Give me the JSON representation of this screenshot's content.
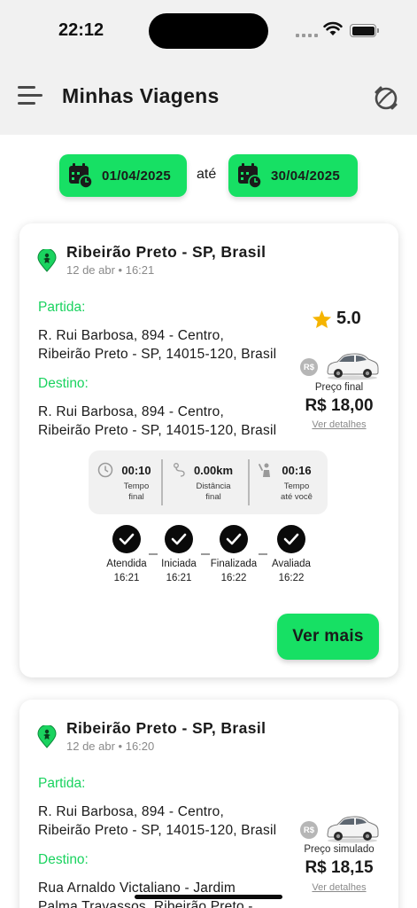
{
  "status_bar": {
    "time": "22:12"
  },
  "header": {
    "title": "Minhas Viagens"
  },
  "filter": {
    "start_date": "01/04/2025",
    "separator": "até",
    "end_date": "30/04/2025"
  },
  "trips": [
    {
      "city": "Ribeirão Preto - SP, Brasil",
      "datetime": "12 de abr • 16:21",
      "departure_label": "Partida:",
      "departure_line1": "R. Rui Barbosa, 894 - Centro,",
      "departure_line2": "Ribeirão Preto - SP, 14015-120, Brasil",
      "destination_label": "Destino:",
      "destination_line1": "R. Rui Barbosa, 894 - Centro,",
      "destination_line2": "Ribeirão Preto - SP, 14015-120, Brasil",
      "rating": "5.0",
      "currency_badge": "R$",
      "price_label": "Preço final",
      "price": "R$ 18,00",
      "details_link": "Ver detalhes",
      "metrics": [
        {
          "icon": "clock-icon",
          "value": "00:10",
          "label_line1": "Tempo",
          "label_line2": "final"
        },
        {
          "icon": "route-icon",
          "value": "0.00km",
          "label_line1": "Distância",
          "label_line2": "final"
        },
        {
          "icon": "person-waving-icon",
          "value": "00:16",
          "label_line1": "Tempo",
          "label_line2": "até você"
        }
      ],
      "steps": [
        {
          "name": "Atendida",
          "time": "16:21"
        },
        {
          "name": "Iniciada",
          "time": "16:21"
        },
        {
          "name": "Finalizada",
          "time": "16:22"
        },
        {
          "name": "Avaliada",
          "time": "16:22"
        }
      ],
      "more_button": "Ver mais"
    },
    {
      "city": "Ribeirão Preto - SP, Brasil",
      "datetime": "12 de abr • 16:20",
      "departure_label": "Partida:",
      "departure_line1": "R. Rui Barbosa, 894 - Centro,",
      "departure_line2": "Ribeirão Preto - SP, 14015-120, Brasil",
      "destination_label": "Destino:",
      "destination_line1": "Rua Arnaldo Victaliano - Jardim",
      "destination_line2": "Palma Travassos, Ribeirão Preto -",
      "currency_badge": "R$",
      "price_label": "Preço simulado",
      "price": "R$ 18,15",
      "details_link": "Ver detalhes"
    }
  ],
  "colors": {
    "accent": "#17e064",
    "accent_text": "#1ad35f",
    "header_bg": "#f1f1f1"
  }
}
